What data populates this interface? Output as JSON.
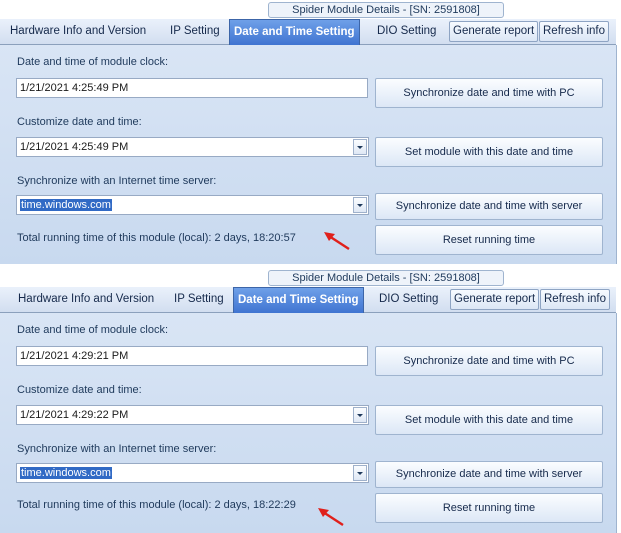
{
  "window_title": "Spider Module Details - [SN: 2591808]",
  "tabs": [
    "Hardware Info and Version",
    "IP Setting",
    "Date and Time Setting",
    "DIO Setting"
  ],
  "tab_buttons": [
    "Generate report",
    "Refresh info"
  ],
  "labels": {
    "module_clock": "Date and time of module clock:",
    "customize": "Customize date and time:",
    "internet": "Synchronize with an Internet time server:"
  },
  "buttons": {
    "sync_pc": "Synchronize date and time with PC",
    "set_module": "Set module with this date and time",
    "sync_server": "Synchronize date and time with server",
    "reset": "Reset running time"
  },
  "panels": [
    {
      "module_clock_value": "1/21/2021 4:25:49 PM",
      "custom_value": "1/21/2021 4:25:49 PM",
      "time_server": "time.windows.com",
      "running_time": "Total running time of this module (local): 2 days, 18:20:57"
    },
    {
      "module_clock_value": "1/21/2021 4:29:21 PM",
      "custom_value": "1/21/2021 4:29:22 PM",
      "time_server": "time.windows.com",
      "running_time": "Total running time of this module (local): 2 days, 18:22:29"
    }
  ],
  "colors": {
    "active_tab": "#4a7fd8",
    "content_bg": "#d3e1f3",
    "annotation_arrow": "#e0201b"
  },
  "icons": [
    "dropdown-arrow-icon",
    "red-arrow-annotation"
  ]
}
